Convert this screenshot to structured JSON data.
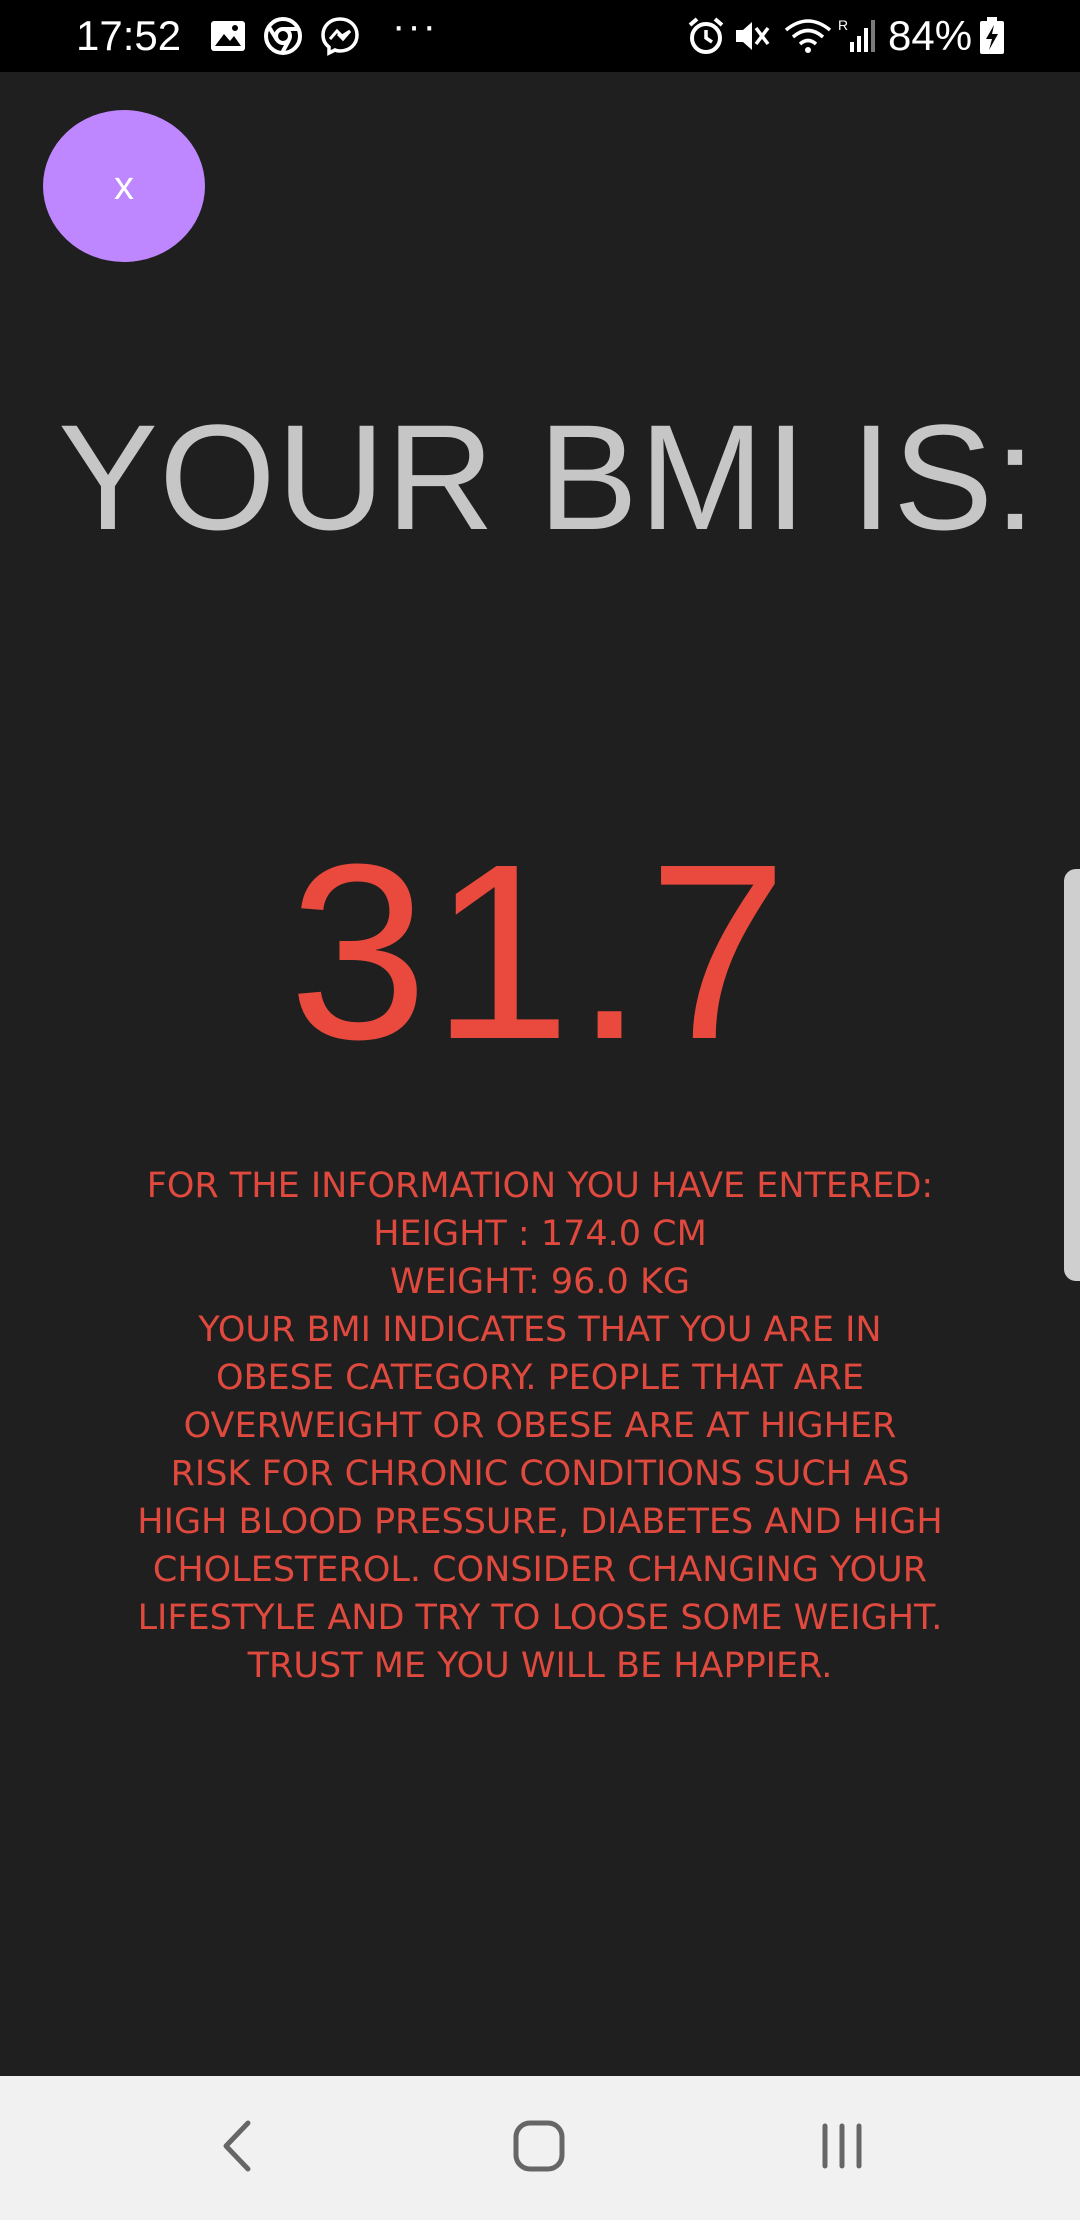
{
  "status_bar": {
    "time": "17:52",
    "overflow_dots": "···",
    "battery_percent": "84%",
    "icons": [
      "gallery-icon",
      "chrome-icon",
      "messenger-icon",
      "alarm-icon",
      "mute-icon",
      "wifi-icon",
      "signal-icon",
      "battery-charging-icon"
    ]
  },
  "close_button": {
    "label": "x",
    "color": "#bf87ff"
  },
  "result": {
    "heading": "YOUR BMI IS:",
    "value": "31.7",
    "value_color": "#ea4a3d",
    "info_lines": [
      "FOR THE INFORMATION YOU HAVE ENTERED:",
      "HEIGHT : 174.0 CM",
      "WEIGHT: 96.0 KG",
      "YOUR BMI INDICATES THAT YOU ARE IN",
      "OBESE CATEGORY. PEOPLE THAT ARE",
      "OVERWEIGHT OR OBESE ARE AT HIGHER",
      "RISK FOR CHRONIC CONDITIONS SUCH AS",
      "HIGH BLOOD PRESSURE, DIABETES AND HIGH",
      "CHOLESTEROL. CONSIDER CHANGING YOUR",
      "LIFESTYLE AND TRY TO LOOSE SOME WEIGHT.",
      "TRUST ME YOU WILL BE HAPPIER."
    ]
  },
  "nav_bar": {
    "buttons": [
      "back-icon",
      "home-icon",
      "recent-apps-icon"
    ]
  }
}
